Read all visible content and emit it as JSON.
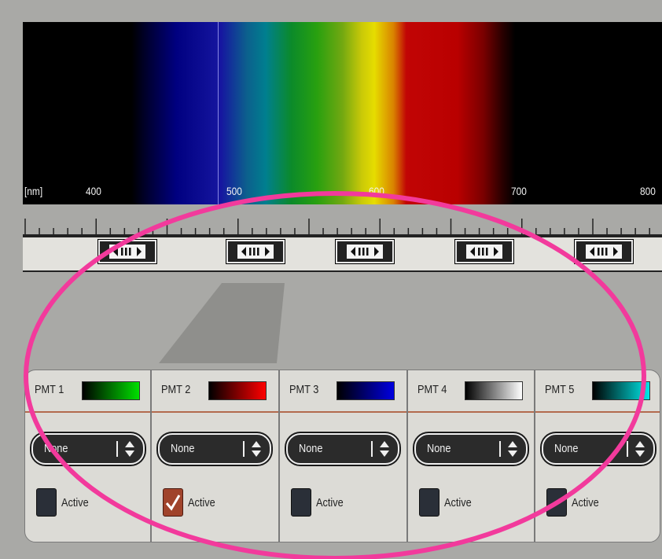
{
  "spectrum": {
    "unit_label": "[nm]",
    "tick_labels": [
      "400",
      "500",
      "600",
      "700",
      "800"
    ]
  },
  "slider_handles": 5,
  "pmt_channels": [
    {
      "label": "PMT 1",
      "lut_color": "#00e000",
      "select_value": "None",
      "active_label": "Active",
      "active": false
    },
    {
      "label": "PMT 2",
      "lut_color": "#ff0000",
      "select_value": "None",
      "active_label": "Active",
      "active": true
    },
    {
      "label": "PMT 3",
      "lut_color": "#0000e0",
      "select_value": "None",
      "active_label": "Active",
      "active": false
    },
    {
      "label": "PMT 4",
      "lut_color": "#ffffff",
      "select_value": "None",
      "active_label": "Active",
      "active": false
    },
    {
      "label": "PMT 5",
      "lut_color": "#00e8e8",
      "select_value": "None",
      "active_label": "Active",
      "active": false
    }
  ],
  "colors": {
    "annotation_ellipse": "#f23a9c",
    "header_divider": "#b36b4e",
    "checkbox_checked": "#a0432b"
  }
}
